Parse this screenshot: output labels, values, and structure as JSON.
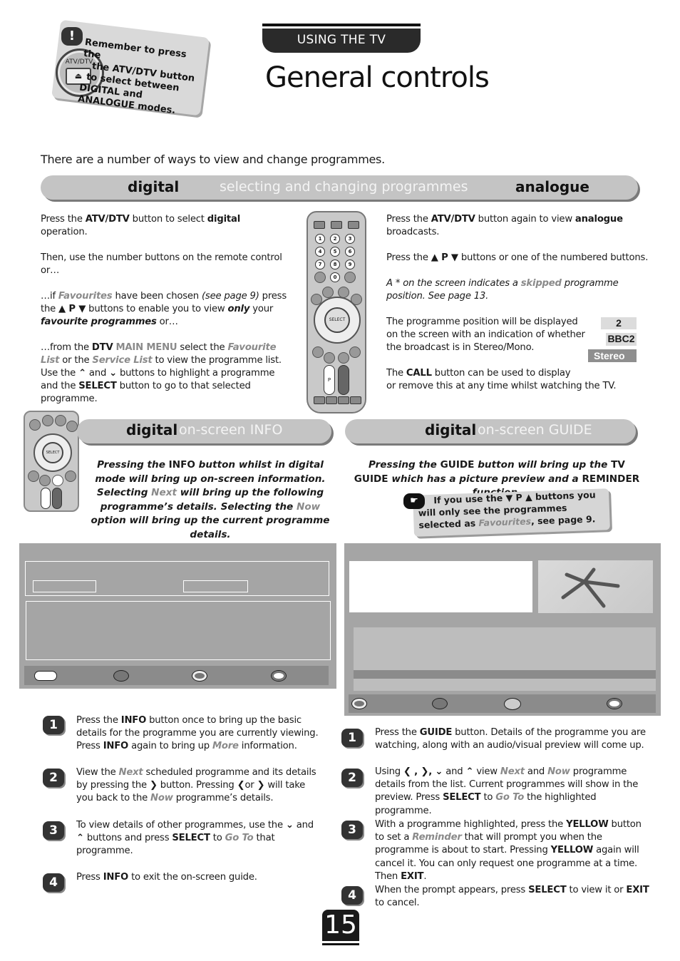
{
  "header": {
    "section_tab": "USING THE TV",
    "title": "General controls"
  },
  "reminder": {
    "icon": "exclamation-icon",
    "badge_label": "ATV/DTV",
    "button_glyph": "⏏",
    "lines": [
      "Remember to press the",
      "the ATV/DTV button",
      "to select between",
      "DIGITAL and",
      "ANALOGUE modes."
    ]
  },
  "intro": "There are a number of ways to view and change programmes.",
  "banner": {
    "left": "digital",
    "middle": "selecting and changing programmes",
    "right": "analogue"
  },
  "digital_col": {
    "p1": {
      "a": "Press the ",
      "b1": "ATV/DTV",
      "c": " button to select ",
      "b2": "digital",
      "d": " operation."
    },
    "p2": "Then, use the number buttons on the remote control or…",
    "p3": {
      "a": "…if ",
      "fav": "Favourites",
      "b": " have been chosen ",
      "see": "(see page 9)",
      "c": " press the ",
      "keys": "▲ P ▼",
      "d": " buttons to enable you to view ",
      "only": "only",
      "e": " your ",
      "favprog": "favourite programmes",
      "f": " or…"
    },
    "p4": {
      "a": "…from the ",
      "dtv": "DTV",
      "sp": " ",
      "menu": "MAIN MENU",
      "b": " select the ",
      "favlist": "Favourite List",
      "c": " or the ",
      "svc": "Service List",
      "d": " to view the programme list. Use the ",
      "up": "⌃",
      "e": " and ",
      "down": "⌄",
      "f": " buttons to highlight a programme and the ",
      "select": "SELECT",
      "g": " button to go to that selected programme."
    }
  },
  "analogue_col": {
    "p1": {
      "a": "Press the ",
      "b1": "ATV/DTV",
      "c": " button again to view ",
      "b2": "analogue",
      "d": " broadcasts."
    },
    "p2": {
      "a": "Press the ",
      "keys": "▲ P ▼",
      "b": " buttons or one of the numbered buttons."
    },
    "p3": {
      "a": "A * on the screen indicates a ",
      "skip": "skipped",
      "b": " programme position. See page 13."
    },
    "p4": "The programme position will be displayed on the screen with an indication of whether the broadcast is in Stereo/Mono.",
    "p5": {
      "a": "The ",
      "call": "CALL",
      "b": " button can be used to display",
      "c": "or remove this at any time whilst watching the TV."
    },
    "osd": {
      "position": "2",
      "channel": "BBC2",
      "sound": "Stereo"
    }
  },
  "remote": {
    "numbers": [
      "1",
      "2",
      "3",
      "4",
      "5",
      "6",
      "7",
      "8",
      "9",
      "0"
    ],
    "select_label": "SELECT",
    "p_label": "P"
  },
  "info_section": {
    "pill_strong": "digital",
    "pill_light": "on-screen INFO",
    "lead": {
      "a": "Pressing the ",
      "info": "INFO",
      "b": " button whilst in digital mode will bring up on-screen information. Selecting ",
      "next": "Next",
      "c": " will bring up the following programme’s details. Selecting the ",
      "now": "Now",
      "d": " option will bring up the current programme details."
    },
    "steps": [
      {
        "num": "1",
        "a": "Press the ",
        "b1": "INFO",
        "c": " button once to bring up the basic details for the programme you are currently viewing. Press ",
        "b2": "INFO",
        "d": " again to bring up ",
        "g": "More",
        "e": " information."
      },
      {
        "num": "2",
        "a": "View the ",
        "g1": "Next",
        "b": " scheduled programme and its details by pressing the ",
        "k1": "❯",
        "c": " button. Pressing ",
        "k2": "❮",
        "d": "or ",
        "k3": "❯",
        "e": " will take you back to the ",
        "g2": "Now",
        "f": " programme’s details."
      },
      {
        "num": "3",
        "a": "To view details of other programmes, use the ",
        "k1": "⌄",
        "b": " and ",
        "k2": "⌃",
        "c": " buttons and press ",
        "b1": "SELECT",
        "d": " to ",
        "g": "Go To",
        "e": " that programme."
      },
      {
        "num": "4",
        "a": "Press ",
        "b1": "INFO",
        "c": " to exit the on-screen guide."
      }
    ]
  },
  "guide_section": {
    "pill_strong": "digital",
    "pill_light": "on-screen GUIDE",
    "lead": {
      "a": "Pressing the ",
      "guide": "GUIDE",
      "b": " button will bring up the ",
      "tv": "TV GUIDE",
      "c": " which has a picture preview and a ",
      "rem": "REMINDER",
      "d": " function."
    },
    "note": {
      "icon": "pointing-hand-icon",
      "a": "If you use the ",
      "keys": "▼ P ▲",
      "b": " buttons you will only see the programmes selected as ",
      "fav": "Favourites",
      "c": ", see page 9."
    },
    "steps": [
      {
        "num": "1",
        "a": "Press the ",
        "b1": "GUIDE",
        "c": " button. Details of the programme you are watching, along with an audio/visual preview will come up."
      },
      {
        "num": "2",
        "a": "Using ",
        "k": "❮ , ❯, ⌄",
        "b": " and ",
        "k2": "⌃",
        "c": " view ",
        "g1": "Next",
        "d": " and ",
        "g2": "Now",
        "e": " programme details from the list. Current programmes will show in the preview. Press ",
        "b1": "SELECT",
        "f": " to ",
        "g3": "Go To",
        "h": " the highlighted programme."
      },
      {
        "num": "3",
        "a": "With a programme highlighted, press the ",
        "b1": "YELLOW",
        "c": " button to set a ",
        "g": "Reminder",
        "d": " that will prompt you when the programme is about to start. Pressing ",
        "b2": "YELLOW",
        "e": " again will cancel it. You can only request one programme at a time. Then ",
        "b3": "EXIT",
        "f": "."
      },
      {
        "num": "4",
        "a": "When the prompt appears, press ",
        "b1": "SELECT",
        "c": " to view it or ",
        "b2": "EXIT",
        "d": " to cancel."
      }
    ]
  },
  "page_number": "15"
}
